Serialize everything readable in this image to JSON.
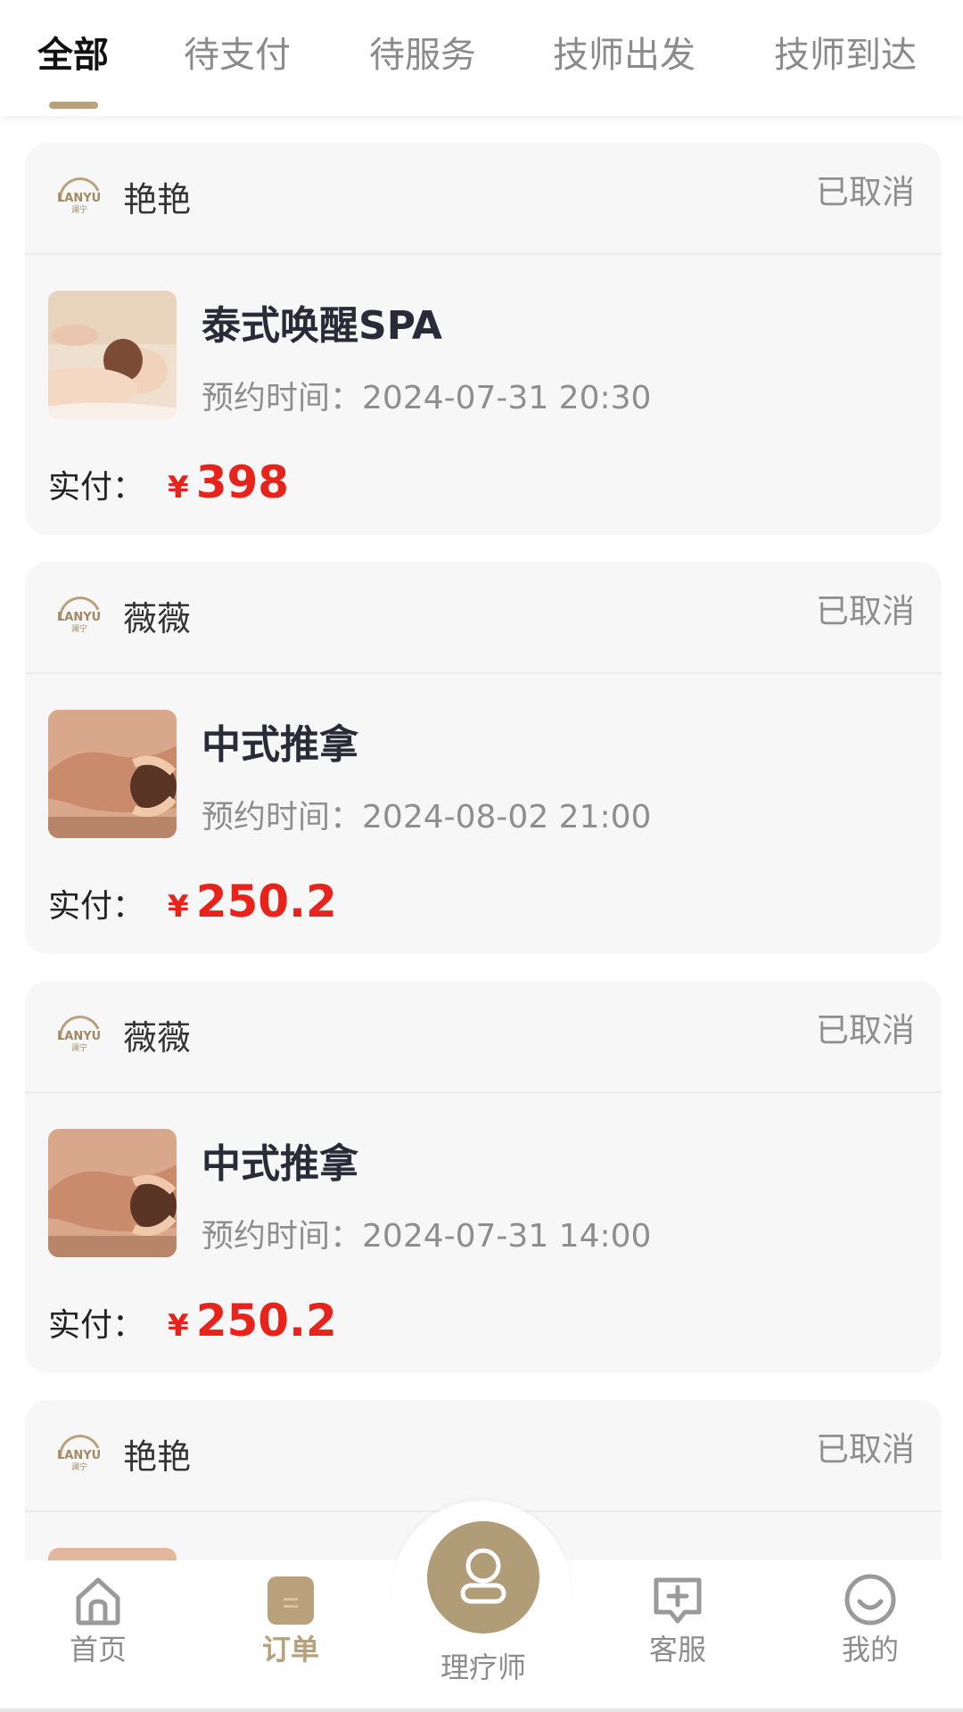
{
  "tabs": [
    "全部",
    "待支付",
    "待服务",
    "技师出发",
    "技师到达"
  ],
  "active_tab": 0,
  "orders": [
    {
      "shop": "艳艳",
      "status": "已取消",
      "service": "泰式唤醒SPA",
      "appointment_label": "预约时间：",
      "appointment_time": "2024-07-31 20:30",
      "paid_label": "实付：",
      "currency": "¥",
      "amount": "398"
    },
    {
      "shop": "薇薇",
      "status": "已取消",
      "service": "中式推拿",
      "appointment_label": "预约时间：",
      "appointment_time": "2024-08-02 21:00",
      "paid_label": "实付：",
      "currency": "¥",
      "amount": "250.2"
    },
    {
      "shop": "薇薇",
      "status": "已取消",
      "service": "中式推拿",
      "appointment_label": "预约时间：",
      "appointment_time": "2024-07-31 14:00",
      "paid_label": "实付：",
      "currency": "¥",
      "amount": "250.2"
    },
    {
      "shop": "艳艳",
      "status": "已取消"
    }
  ],
  "logo_text": "LANYU",
  "nav": {
    "home": "首页",
    "orders": "订单",
    "therapist": "理疗师",
    "service": "客服",
    "mine": "我的"
  },
  "colors": {
    "accent": "#b9a17c",
    "price": "#e8231c",
    "card_bg": "#f7f7f7"
  },
  "icons": {
    "home": "home-icon",
    "orders": "order-list-icon",
    "therapist": "therapist-icon",
    "service": "chat-plus-icon",
    "mine": "smile-user-icon"
  }
}
